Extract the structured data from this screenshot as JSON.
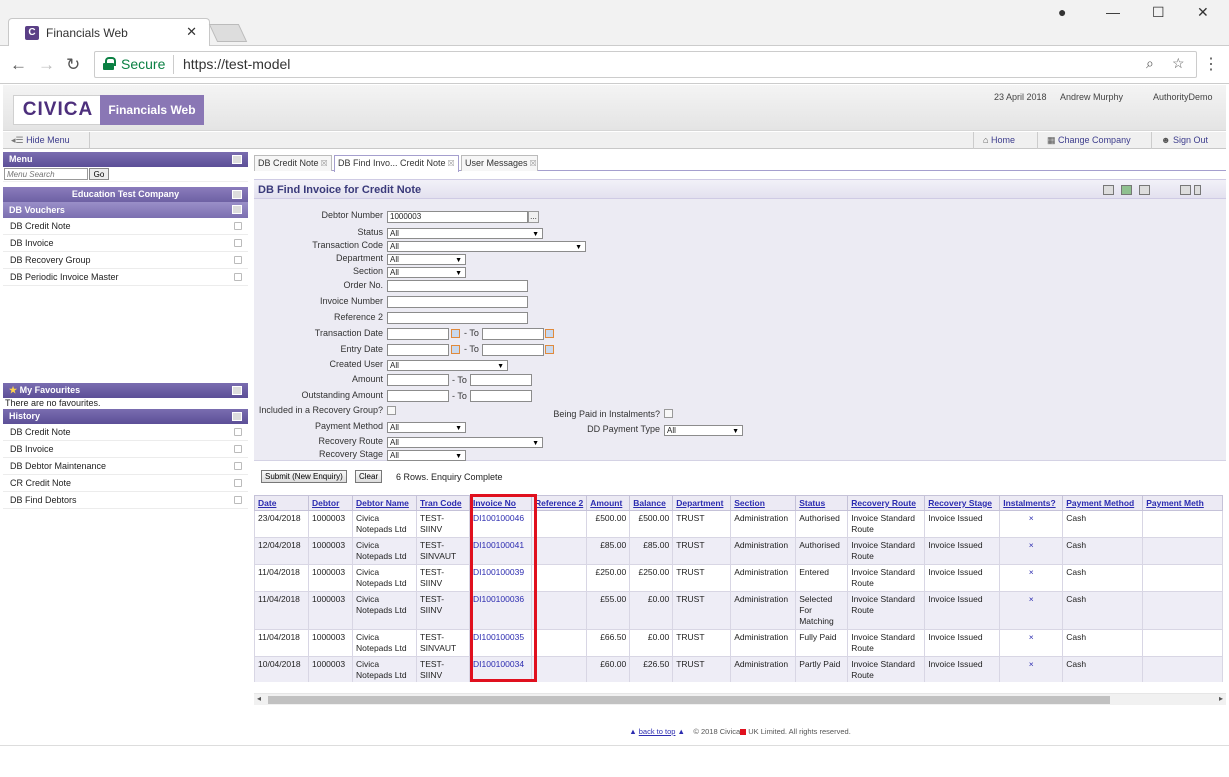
{
  "browser": {
    "tab_title": "Financials Web",
    "tab_favicon": "C",
    "secure_label": "Secure",
    "url": "https://test-model"
  },
  "app": {
    "logo": "CIVICA",
    "product": "Financials Web",
    "date": "23 April 2018",
    "user": "Andrew Murphy",
    "authority": "AuthorityDemo"
  },
  "toolbar": {
    "hide_menu": "Hide Menu",
    "home": "Home",
    "change_company": "Change Company",
    "sign_out": "Sign Out"
  },
  "sidebar": {
    "menu_title": "Menu",
    "search_placeholder": "Menu Search",
    "go_label": "Go",
    "company": "Education Test Company",
    "vouchers_title": "DB Vouchers",
    "vouchers": [
      "DB Credit Note",
      "DB Invoice",
      "DB Recovery Group",
      "DB Periodic Invoice Master"
    ],
    "favourites_title": "My Favourites",
    "favourites_empty": "There are no favourites.",
    "history_title": "History",
    "history": [
      "DB Credit Note",
      "DB Invoice",
      "DB Debtor Maintenance",
      "CR Credit Note",
      "DB Find Debtors"
    ]
  },
  "tabs": [
    {
      "label": "DB Credit Note"
    },
    {
      "label": "DB Find Invo... Credit Note"
    },
    {
      "label": "User Messages"
    }
  ],
  "form": {
    "title": "DB Find Invoice for Credit Note",
    "debtor_number_label": "Debtor Number",
    "debtor_number_value": "1000003",
    "status_label": "Status",
    "status_value": "All",
    "transaction_code_label": "Transaction Code",
    "transaction_code_value": "All",
    "department_label": "Department",
    "department_value": "All",
    "section_label": "Section",
    "section_value": "All",
    "order_no_label": "Order No.",
    "invoice_number_label": "Invoice Number",
    "reference2_label": "Reference 2",
    "transaction_date_label": "Transaction Date",
    "entry_date_label": "Entry Date",
    "to_label": "- To",
    "created_user_label": "Created User",
    "created_user_value": "All",
    "amount_label": "Amount",
    "outstanding_amount_label": "Outstanding Amount",
    "recovery_group_label": "Included in a Recovery Group?",
    "instalments_label": "Being Paid in Instalments?",
    "payment_method_label": "Payment Method",
    "payment_method_value": "All",
    "dd_payment_type_label": "DD Payment Type",
    "dd_payment_type_value": "All",
    "recovery_route_label": "Recovery Route",
    "recovery_route_value": "All",
    "recovery_stage_label": "Recovery Stage",
    "recovery_stage_value": "All",
    "lookup_label": "..."
  },
  "actions": {
    "submit": "Submit (New Enquiry)",
    "clear": "Clear",
    "status": "6 Rows. Enquiry Complete"
  },
  "grid": {
    "columns": [
      "Date",
      "Debtor",
      "Debtor Name",
      "Tran Code",
      "Invoice No",
      "Reference 2",
      "Amount",
      "Balance",
      "Department",
      "Section",
      "Status",
      "Recovery Route",
      "Recovery Stage",
      "Instalments?",
      "Payment Method",
      "Payment Meth"
    ],
    "rows": [
      [
        "23/04/2018",
        "1000003",
        "Civica Notepads Ltd",
        "TEST-SIINV",
        "DI100100046",
        "",
        "£500.00",
        "£500.00",
        "TRUST",
        "Administration",
        "Authorised",
        "Invoice Standard Route",
        "Invoice Issued",
        "×",
        "Cash",
        ""
      ],
      [
        "12/04/2018",
        "1000003",
        "Civica Notepads Ltd",
        "TEST-SINVAUT",
        "DI100100041",
        "",
        "£85.00",
        "£85.00",
        "TRUST",
        "Administration",
        "Authorised",
        "Invoice Standard Route",
        "Invoice Issued",
        "×",
        "Cash",
        ""
      ],
      [
        "11/04/2018",
        "1000003",
        "Civica Notepads Ltd",
        "TEST-SIINV",
        "DI100100039",
        "",
        "£250.00",
        "£250.00",
        "TRUST",
        "Administration",
        "Entered",
        "Invoice Standard Route",
        "Invoice Issued",
        "×",
        "Cash",
        ""
      ],
      [
        "11/04/2018",
        "1000003",
        "Civica Notepads Ltd",
        "TEST-SIINV",
        "DI100100036",
        "",
        "£55.00",
        "£0.00",
        "TRUST",
        "Administration",
        "Selected For Matching",
        "Invoice Standard Route",
        "Invoice Issued",
        "×",
        "Cash",
        ""
      ],
      [
        "11/04/2018",
        "1000003",
        "Civica Notepads Ltd",
        "TEST-SINVAUT",
        "DI100100035",
        "",
        "£66.50",
        "£0.00",
        "TRUST",
        "Administration",
        "Fully Paid",
        "Invoice Standard Route",
        "Invoice Issued",
        "×",
        "Cash",
        ""
      ],
      [
        "10/04/2018",
        "1000003",
        "Civica Notepads Ltd",
        "TEST-SIINV",
        "DI100100034",
        "",
        "£60.00",
        "£26.50",
        "TRUST",
        "Administration",
        "Partly Paid",
        "Invoice Standard Route",
        "Invoice Issued",
        "×",
        "Cash",
        ""
      ]
    ]
  },
  "footer": {
    "back_to_top": "back to top",
    "copyright_a": "© 2018 Civica",
    "copyright_b": "UK Limited. All rights reserved."
  },
  "colors": {
    "accent": "#5c4f97",
    "highlight": "#e0101e",
    "link": "#2c2cb0"
  }
}
